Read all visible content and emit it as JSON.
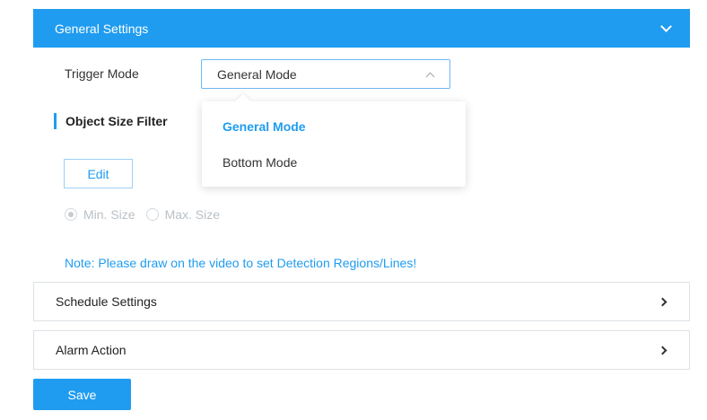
{
  "general_settings": {
    "title": "General Settings",
    "expanded": true,
    "trigger_mode": {
      "label": "Trigger Mode",
      "selected": "General Mode",
      "options": [
        "General Mode",
        "Bottom Mode"
      ]
    },
    "object_size_filter": {
      "title": "Object Size Filter",
      "edit_label": "Edit",
      "radio_options": [
        {
          "label": "Min. Size",
          "checked": true,
          "disabled": true
        },
        {
          "label": "Max. Size",
          "checked": false,
          "disabled": true
        }
      ]
    },
    "note": "Note: Please draw on the video to set Detection Regions/Lines!"
  },
  "panels": [
    {
      "title": "Schedule Settings",
      "expanded": false
    },
    {
      "title": "Alarm Action",
      "expanded": false
    }
  ],
  "save_label": "Save",
  "colors": {
    "accent": "#1f9cf0",
    "disabled_text": "#b9c0c6",
    "border": "#dde2e6"
  },
  "icons": {
    "header_chevron": "chevron-down-icon",
    "select_chevron": "chevron-up-icon",
    "panel_chevron": "chevron-right-icon"
  }
}
